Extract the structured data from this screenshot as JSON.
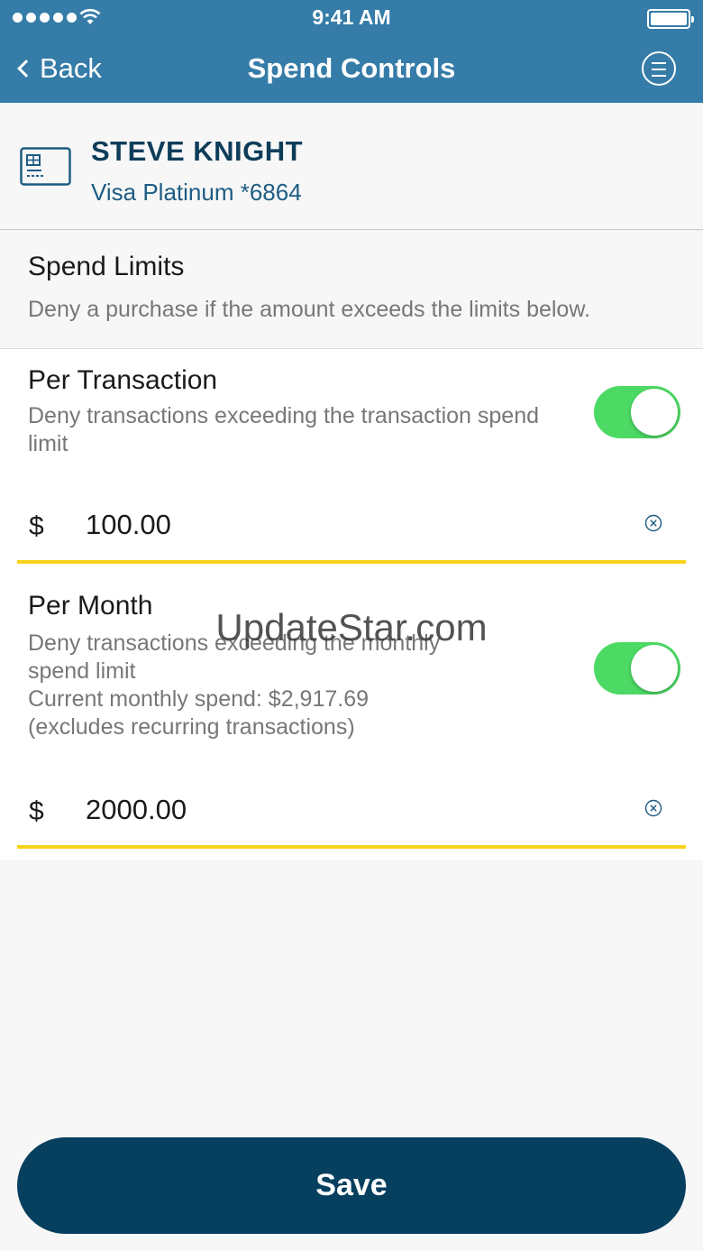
{
  "status_bar": {
    "time": "9:41 AM",
    "icons": [
      "signal-dots-icon",
      "wifi-icon",
      "battery-icon"
    ]
  },
  "nav": {
    "back_label": "Back",
    "title": "Spend Controls",
    "menu_icon": "menu-icon"
  },
  "card": {
    "holder_name": "STEVE KNIGHT",
    "card_name": "Visa Platinum *6864",
    "icon": "credit-card-icon"
  },
  "spend_limits": {
    "title": "Spend Limits",
    "subtitle": "Deny a purchase if the amount exceeds the limits below."
  },
  "per_transaction": {
    "title": "Per Transaction",
    "description": "Deny transactions exceeding the transaction spend limit",
    "enabled": true,
    "currency": "$",
    "amount": "100.00"
  },
  "per_month": {
    "title": "Per Month",
    "description": "Deny transactions exceeding the monthly spend limit",
    "current_spend": "Current monthly spend: $2,917.69",
    "note": "(excludes recurring transactions)",
    "enabled": true,
    "currency": "$",
    "amount": "2000.00"
  },
  "watermark": "UpdateStar.com",
  "save_label": "Save",
  "colors": {
    "header_blue": "#357ca8",
    "accent_navy": "#073f5e",
    "toggle_green": "#4cd964",
    "underline_yellow": "#f7d31b"
  }
}
